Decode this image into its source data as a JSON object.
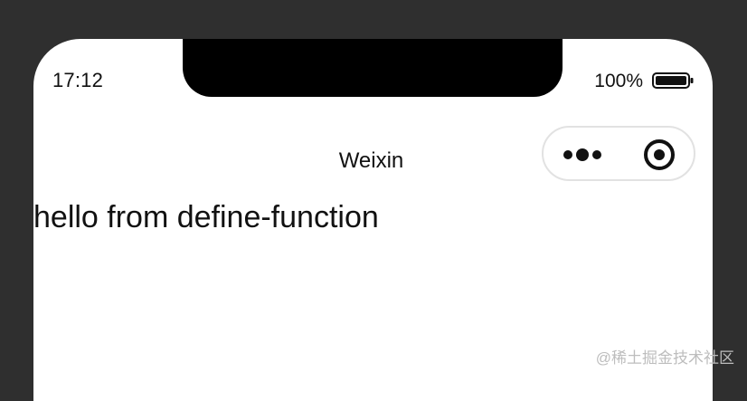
{
  "status_bar": {
    "time": "17:12",
    "battery_text": "100%"
  },
  "nav_bar": {
    "title": "Weixin"
  },
  "content": {
    "text": "hello from define-function"
  },
  "watermark": {
    "text": "@稀土掘金技术社区"
  },
  "icons": {
    "battery": "battery-icon",
    "more": "more-icon",
    "close": "close-icon"
  },
  "colors": {
    "background": "#2f2f2f",
    "screen": "#ffffff",
    "text": "#111111",
    "capsule_border": "#e2e2e2"
  }
}
